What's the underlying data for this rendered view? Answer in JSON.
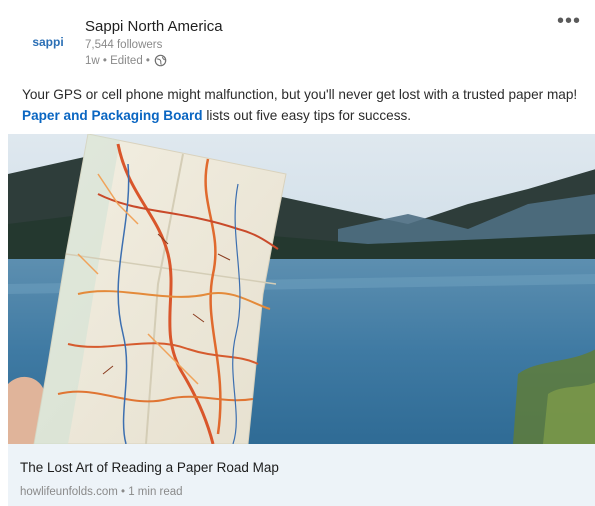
{
  "post": {
    "company": "Sappi North America",
    "logo_text": "sappi",
    "followers": "7,544 followers",
    "meta": "1w • Edited •",
    "more_label": "•••",
    "body_before": "Your GPS or cell phone might malfunction, but you'll never get lost with a trusted paper map! ",
    "body_link": "Paper and Packaging Board",
    "body_after": " lists out five easy tips for success."
  },
  "link_card": {
    "title": "The Lost Art of Reading a Paper Road Map",
    "source": "howlifeunfolds.com • 1 min read"
  },
  "colors": {
    "link": "#0a66c2",
    "logo": "#2b6fb5",
    "card_footer_bg": "#edf3f8"
  }
}
